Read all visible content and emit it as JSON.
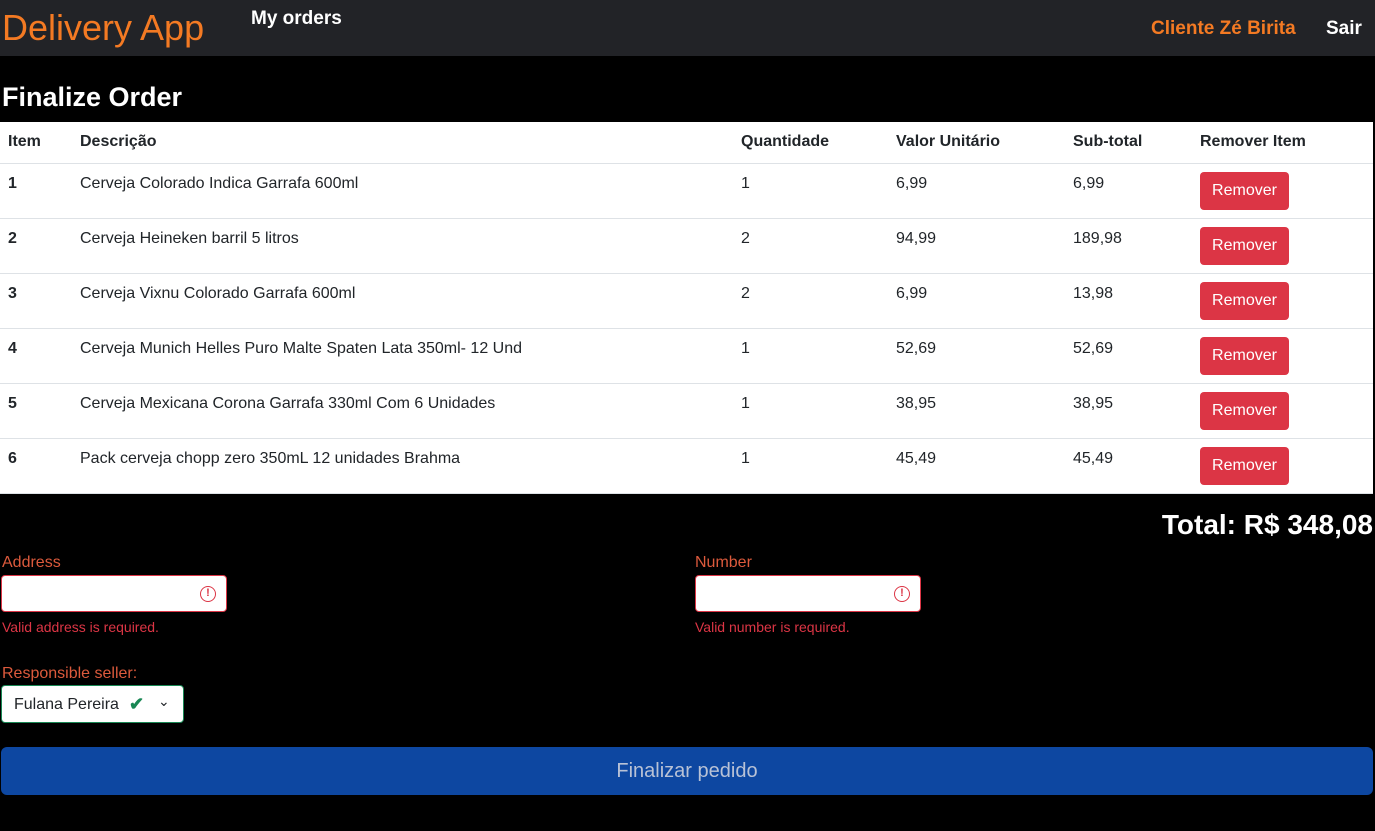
{
  "navbar": {
    "brand": "Delivery App",
    "orders_link": "My orders",
    "client_name": "Cliente Zé Birita",
    "logout": "Sair"
  },
  "page_title": "Finalize Order",
  "table": {
    "headers": [
      "Item",
      "Descrição",
      "Quantidade",
      "Valor Unitário",
      "Sub-total",
      "Remover Item"
    ],
    "rows": [
      {
        "item": "1",
        "desc": "Cerveja Colorado Indica Garrafa 600ml",
        "qty": "1",
        "unit": "6,99",
        "sub": "6,99",
        "remove": "Remover"
      },
      {
        "item": "2",
        "desc": "Cerveja Heineken barril 5 litros",
        "qty": "2",
        "unit": "94,99",
        "sub": "189,98",
        "remove": "Remover"
      },
      {
        "item": "3",
        "desc": "Cerveja Vixnu Colorado Garrafa 600ml",
        "qty": "2",
        "unit": "6,99",
        "sub": "13,98",
        "remove": "Remover"
      },
      {
        "item": "4",
        "desc": "Cerveja Munich Helles Puro Malte Spaten Lata 350ml- 12 Und",
        "qty": "1",
        "unit": "52,69",
        "sub": "52,69",
        "remove": "Remover"
      },
      {
        "item": "5",
        "desc": "Cerveja Mexicana Corona Garrafa 330ml Com 6 Unidades",
        "qty": "1",
        "unit": "38,95",
        "sub": "38,95",
        "remove": "Remover"
      },
      {
        "item": "6",
        "desc": "Pack cerveja chopp zero 350mL 12 unidades Brahma",
        "qty": "1",
        "unit": "45,49",
        "sub": "45,49",
        "remove": "Remover"
      }
    ]
  },
  "total": "Total: R$ 348,08",
  "form": {
    "address_label": "Address",
    "address_value": "",
    "address_error": "Valid address is required.",
    "number_label": "Number",
    "number_value": "",
    "number_error": "Valid number is required.",
    "seller_label": "Responsible seller:",
    "seller_selected": "Fulana Pereira",
    "submit": "Finalizar pedido"
  },
  "colors": {
    "brand": "#f47a23",
    "danger": "#dc3545",
    "success": "#198754",
    "primary": "#0d47a1"
  },
  "icons": {
    "error": "exclamation-circle-icon",
    "valid": "check-icon",
    "dropdown": "chevron-down-icon"
  }
}
